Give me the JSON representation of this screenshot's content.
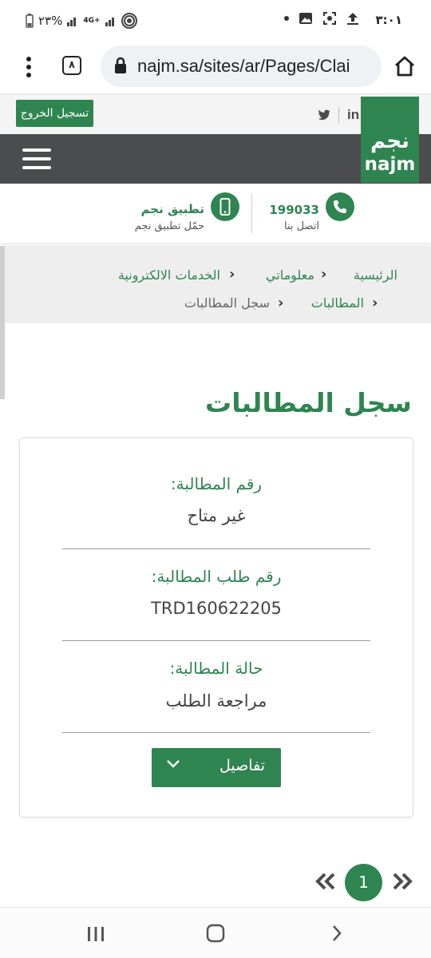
{
  "status_bar": {
    "time": "٣:٠١",
    "battery": "٢٣%",
    "network": "4G+"
  },
  "browser": {
    "url": "najm.sa/sites/ar/Pages/Clai",
    "tab_count": "٨"
  },
  "site": {
    "logout_label": "تسجيل الخروج",
    "logo_ar": "نجم",
    "logo_en": "najm",
    "social": [
      "linkedin-icon",
      "twitter-icon"
    ],
    "brand_color": "#2e8550"
  },
  "contact": {
    "phone_number": "199033",
    "phone_label": "اتصل بنا",
    "app_title": "تطبيق نجم",
    "app_label": "حمّل تطبيق نجم"
  },
  "breadcrumb": {
    "items": [
      "الرئيسية",
      "معلوماتي",
      "الخدمات الالكترونية",
      "المطالبات",
      "سجل المطالبات"
    ]
  },
  "page": {
    "title": "سجل المطالبات"
  },
  "claim": {
    "claim_number_label": "رقم المطالبة:",
    "claim_number_value": "غير متاح",
    "request_number_label": "رقم طلب المطالبة:",
    "request_number_value": "TRD160622205",
    "status_label": "حالة المطالبة:",
    "status_value": "مراجعة الطلب",
    "details_button": "تفاصيل"
  },
  "pagination": {
    "current_page": "1"
  }
}
